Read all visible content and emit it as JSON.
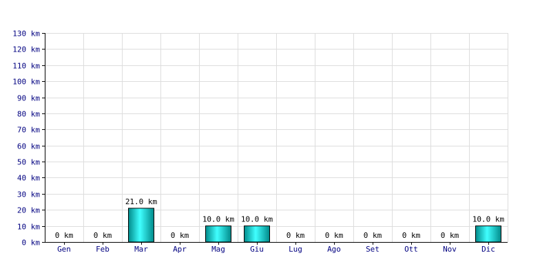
{
  "chart_data": {
    "type": "bar",
    "title": "",
    "xlabel": "",
    "ylabel": "",
    "unit": "km",
    "categories": [
      "Gen",
      "Feb",
      "Mar",
      "Apr",
      "Mag",
      "Giu",
      "Lug",
      "Ago",
      "Set",
      "Ott",
      "Nov",
      "Dic"
    ],
    "values": [
      0,
      0,
      21.0,
      0,
      10.0,
      10.0,
      0,
      0,
      0,
      0,
      0,
      10.0
    ],
    "data_labels": [
      "0 km",
      "0 km",
      "21.0 km",
      "0 km",
      "10.0 km",
      "10.0 km",
      "0 km",
      "0 km",
      "0 km",
      "0 km",
      "0 km",
      "10.0 km"
    ],
    "ylim": [
      0,
      130
    ],
    "yticks": [
      0,
      10,
      20,
      30,
      40,
      50,
      60,
      70,
      80,
      90,
      100,
      110,
      120,
      130
    ],
    "ytick_labels": [
      "0 km",
      "10 km",
      "20 km",
      "30 km",
      "40 km",
      "50 km",
      "60 km",
      "70 km",
      "80 km",
      "90 km",
      "100 km",
      "110 km",
      "120 km",
      "130 km"
    ],
    "grid": true,
    "legend": "none",
    "colors": {
      "bar_light": "#40ffff",
      "bar_mid": "#00c8c8",
      "bar_dark": "#008a8a",
      "bar_edge": "#000000",
      "grid": "#dddddd",
      "axis": "#000000",
      "tick_text": "#000080",
      "label_text": "#000000"
    }
  }
}
